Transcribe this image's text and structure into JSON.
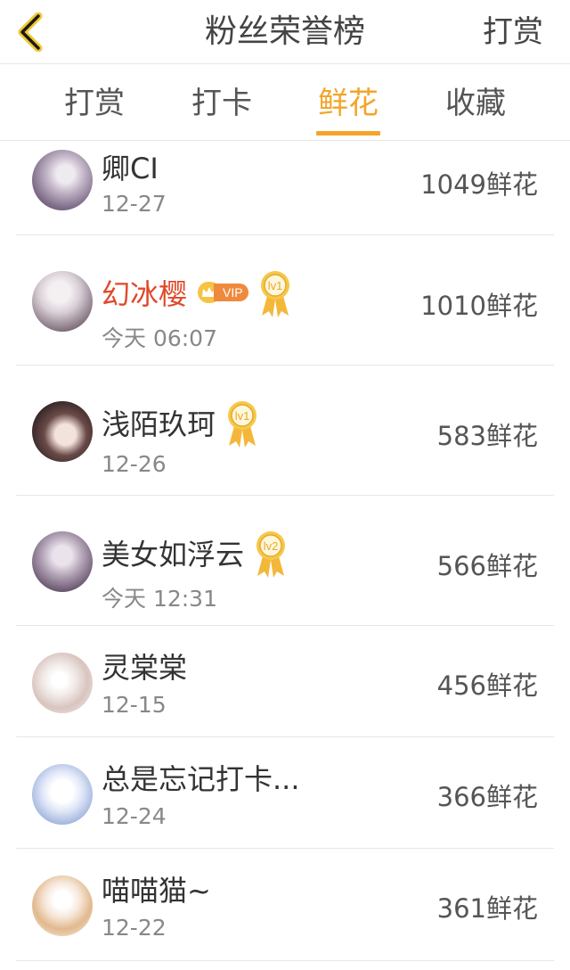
{
  "header": {
    "title": "粉丝荣誉榜",
    "right_label": "打赏"
  },
  "tabs": [
    {
      "label": "打赏",
      "active": false
    },
    {
      "label": "打卡",
      "active": false
    },
    {
      "label": "鲜花",
      "active": true
    },
    {
      "label": "收藏",
      "active": false
    }
  ],
  "colors": {
    "accent": "#f3a52a",
    "vip_name": "#e0482a"
  },
  "fans": [
    {
      "name": "卿CI",
      "time": "12-27",
      "count": "1049鲜花",
      "vip": false,
      "medal": ""
    },
    {
      "name": "幻冰樱",
      "time": "今天 06:07",
      "count": "1010鲜花",
      "vip": true,
      "vip_badge": "VIP",
      "medal": "lv1"
    },
    {
      "name": "浅陌玖珂",
      "time": "12-26",
      "count": "583鲜花",
      "vip": false,
      "medal": "lv1"
    },
    {
      "name": "美女如浮云",
      "time": "今天 12:31",
      "count": "566鲜花",
      "vip": false,
      "medal": "lv2"
    },
    {
      "name": "灵棠棠",
      "time": "12-15",
      "count": "456鲜花",
      "vip": false,
      "medal": ""
    },
    {
      "name": "总是忘记打卡...",
      "time": "12-24",
      "count": "366鲜花",
      "vip": false,
      "medal": ""
    },
    {
      "name": "喵喵猫~",
      "time": "12-22",
      "count": "361鲜花",
      "vip": false,
      "medal": ""
    }
  ]
}
